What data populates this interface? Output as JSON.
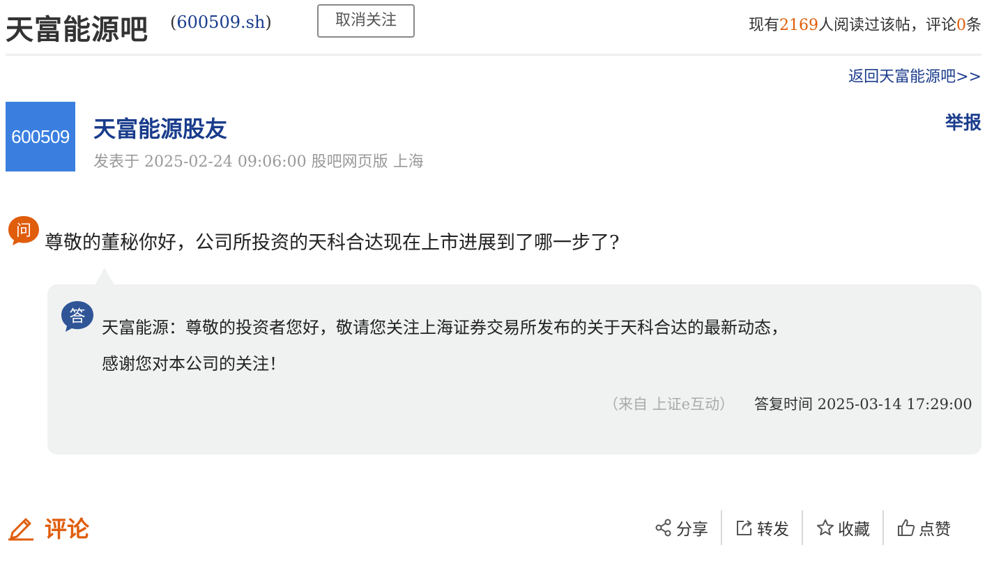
{
  "header": {
    "bar_name": "天富能源吧",
    "code_open": "(",
    "code": "600509.sh",
    "code_close": ")",
    "unfollow_label": "取消关注",
    "read_prefix": "现有",
    "read_count": "2169",
    "read_mid": "人阅读过该帖，评论",
    "comment_count": "0",
    "read_suffix": "条"
  },
  "back_link": "返回天富能源吧>>",
  "post": {
    "avatar_text": "600509",
    "author": "天富能源股友",
    "meta": "发表于 2025-02-24 09:06:00 股吧网页版   上海",
    "report_label": "举报"
  },
  "qa": {
    "q_icon_char": "问",
    "question": "尊敬的董秘你好，公司所投资的天科合达现在上市进展到了哪一步了?",
    "a_icon_char": "答",
    "answer_line1": "天富能源：尊敬的投资者您好，敬请您关注上海证券交易所发布的关于天科合达的最新动态，",
    "answer_line2": "感谢您对本公司的关注！",
    "source": "（来自 上证e互动）",
    "answer_time": "答复时间 2025-03-14 17:29:00"
  },
  "comments": {
    "title": "评论"
  },
  "actions": {
    "share": "分享",
    "forward": "转发",
    "collect": "收藏",
    "like": "点赞"
  },
  "colors": {
    "link_blue": "#1a3c8c",
    "accent_orange": "#e05d0c",
    "answer_icon_blue": "#2f5597",
    "avatar_blue": "#3a7fe0"
  }
}
